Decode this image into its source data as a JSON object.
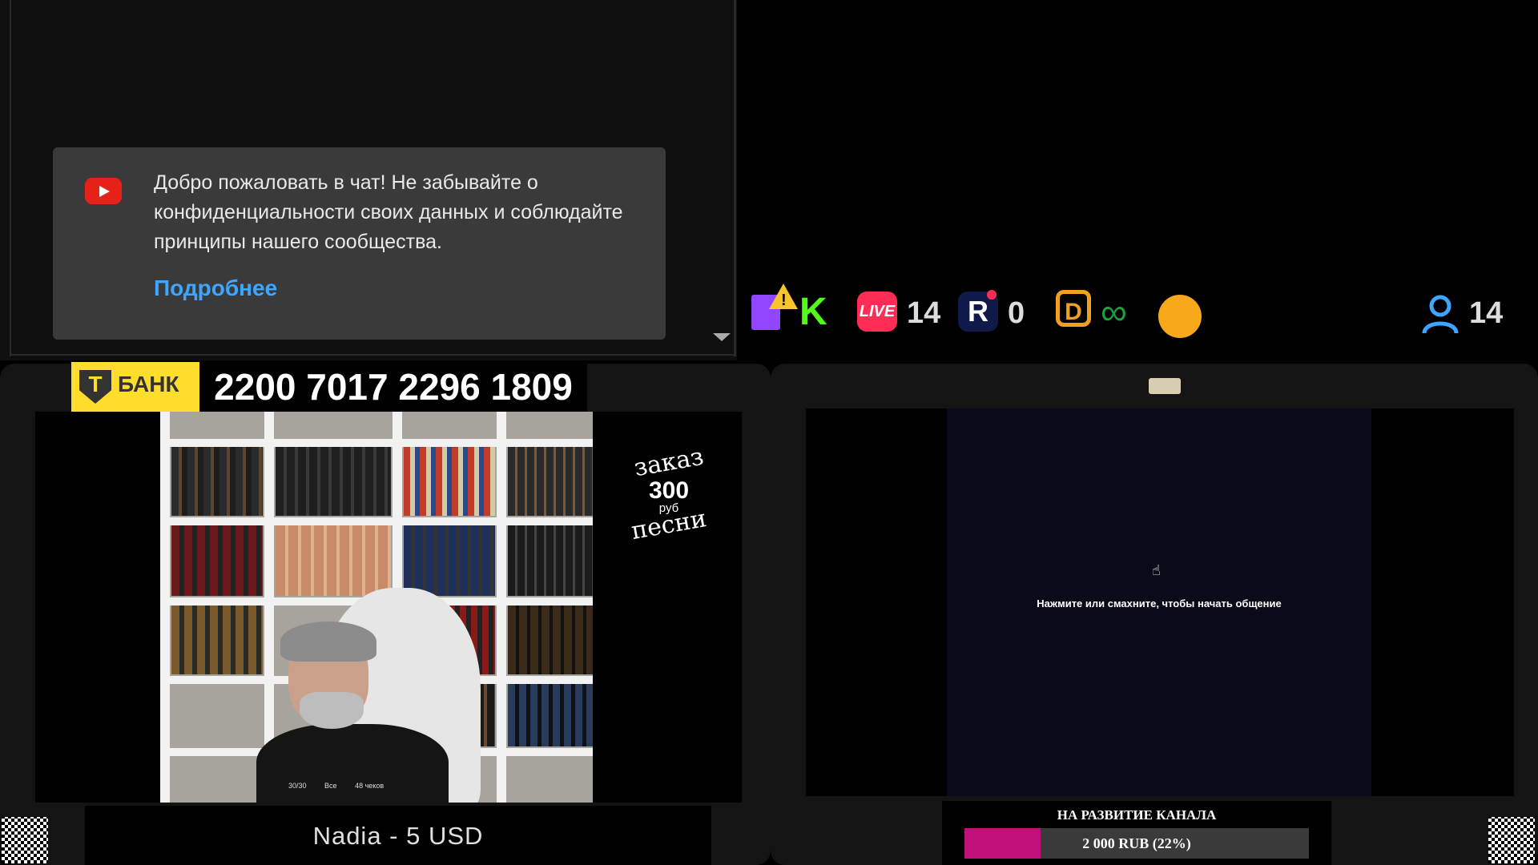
{
  "chat": {
    "welcome_text": "Добро пожаловать в чат! Не забывайте о конфиденциальности своих данных и соблюдайте принципы нашего сообщества.",
    "more_link": "Подробнее"
  },
  "status_bar": {
    "vklive_label": "LIVE",
    "vklive_count": "14",
    "rutube_label": "R",
    "rutube_count": "0",
    "viewers_count": "14",
    "icons": [
      "twitch-warning-icon",
      "kick-icon",
      "vklive-icon",
      "rutube-icon",
      "dlive-icon",
      "infinity-icon",
      "orange-circle-icon",
      "viewer-icon"
    ]
  },
  "bank": {
    "t_letter": "T",
    "name": "БАНК",
    "card_number": "2200 7017 2296 1809"
  },
  "song_order": {
    "top": "заказ",
    "price": "300",
    "currency": "руб",
    "bottom": "песни"
  },
  "camera_overlay": {
    "counter": "30/30",
    "filter": "Все",
    "checks": "48 чеков"
  },
  "donation": {
    "text": "Nadia - 5 USD"
  },
  "right_screen": {
    "hint": "Нажмите или смахните, чтобы начать общение"
  },
  "goal": {
    "title": "НА РАЗВИТИЕ КАНАЛА",
    "label": "2 000 RUB (22%)",
    "progress": 0.22
  },
  "colors": {
    "youtube_red": "#e62117",
    "link_blue": "#3ea6ff",
    "bank_yellow": "#ffdd2d",
    "goal_fill": "#c0107a",
    "kick_green": "#53fc18"
  }
}
